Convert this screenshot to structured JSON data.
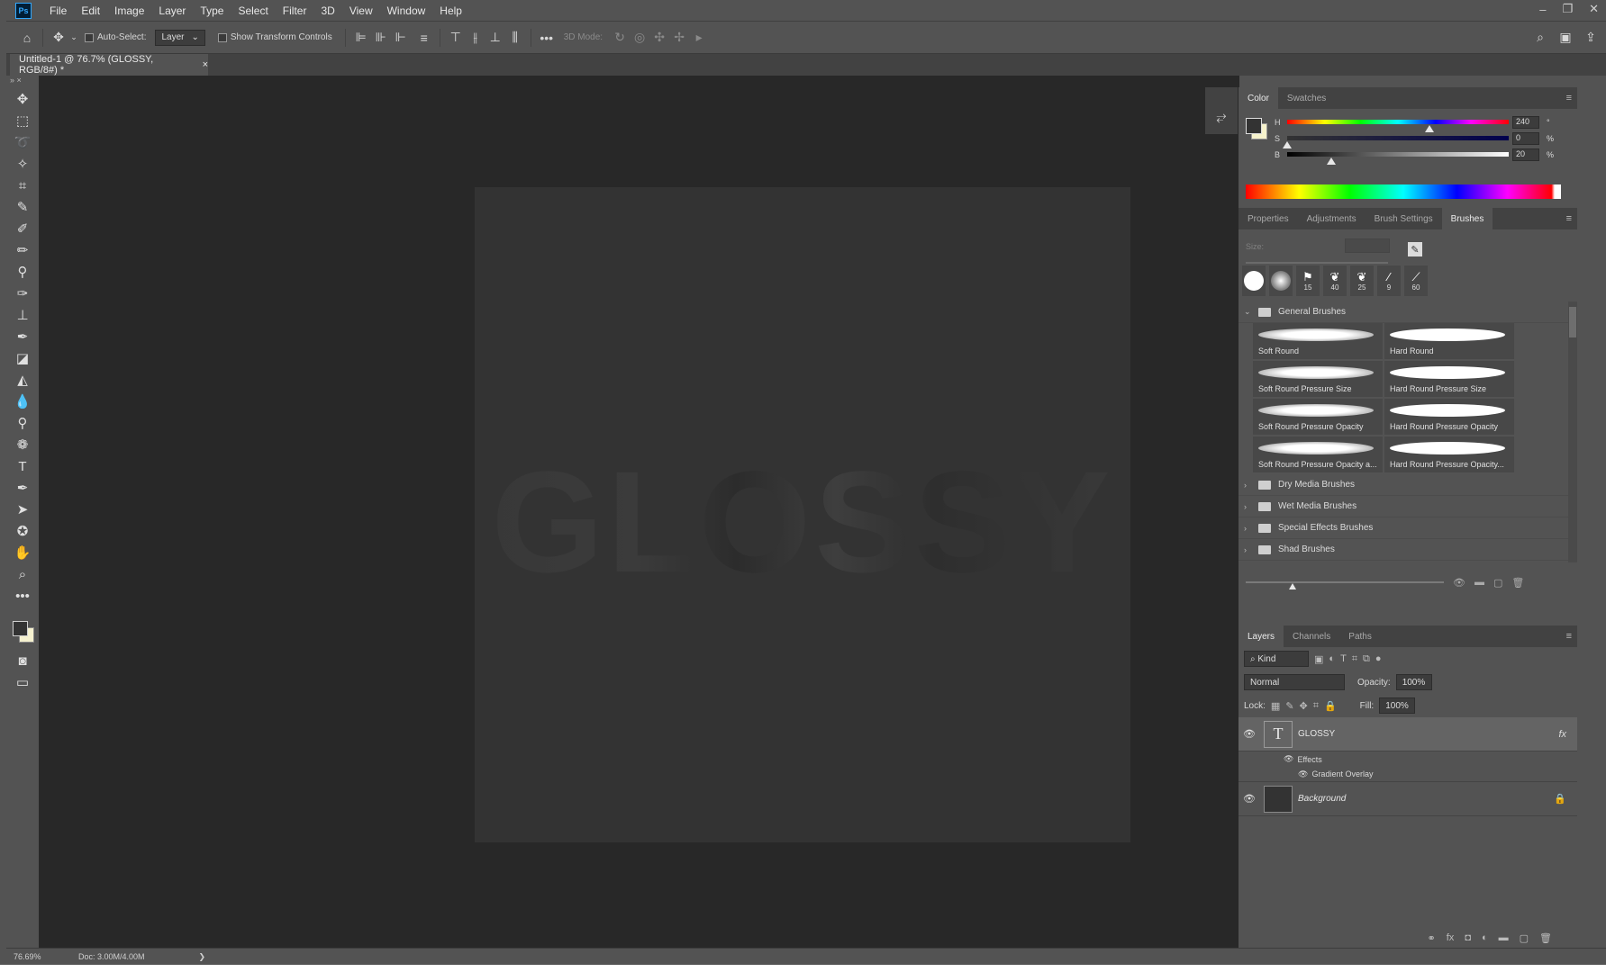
{
  "app": {
    "logo": "Ps"
  },
  "menu": [
    "File",
    "Edit",
    "Image",
    "Layer",
    "Type",
    "Select",
    "Filter",
    "3D",
    "View",
    "Window",
    "Help"
  ],
  "options": {
    "auto_select_label": "Auto-Select:",
    "auto_select_value": "Layer",
    "show_transform_label": "Show Transform Controls",
    "mode_3d_label": "3D Mode:",
    "more": "•••"
  },
  "document": {
    "tab_title": "Untitled-1 @ 76.7% (GLOSSY, RGB/8#) *",
    "close": "×",
    "canvas_text": "GLOSSY"
  },
  "color_panel": {
    "tabs": [
      "Color",
      "Swatches"
    ],
    "active_tab": "Color",
    "sliders": [
      {
        "label": "H",
        "value": "240",
        "unit": "°",
        "level": 0.66
      },
      {
        "label": "S",
        "value": "0",
        "unit": "%",
        "level": 0.0
      },
      {
        "label": "B",
        "value": "20",
        "unit": "%",
        "level": 0.2
      }
    ],
    "foreground": "#333333",
    "background": "#f5f1cf"
  },
  "brushes_panel": {
    "tabs": [
      "Properties",
      "Adjustments",
      "Brush Settings",
      "Brushes"
    ],
    "active_tab": "Brushes",
    "size_label": "Size:",
    "presets": [
      {
        "kind": "hard",
        "num": ""
      },
      {
        "kind": "soft",
        "num": ""
      },
      {
        "kind": "glyph",
        "glyph": "⚑",
        "num": "15"
      },
      {
        "kind": "glyph",
        "glyph": "❦",
        "num": "40"
      },
      {
        "kind": "glyph",
        "glyph": "❦",
        "num": "25"
      },
      {
        "kind": "glyph",
        "glyph": "⁄",
        "num": "9"
      },
      {
        "kind": "glyph",
        "glyph": "⟋",
        "num": "60"
      }
    ],
    "general_folder": "General Brushes",
    "brushes": [
      {
        "name": "Soft Round",
        "soft": true
      },
      {
        "name": "Hard Round",
        "soft": false
      },
      {
        "name": "Soft Round Pressure Size",
        "soft": true
      },
      {
        "name": "Hard Round Pressure Size",
        "soft": false
      },
      {
        "name": "Soft Round Pressure Opacity",
        "soft": true
      },
      {
        "name": "Hard Round Pressure Opacity",
        "soft": false
      },
      {
        "name": "Soft Round Pressure Opacity a...",
        "soft": true
      },
      {
        "name": "Hard Round Pressure Opacity...",
        "soft": false
      }
    ],
    "folders": [
      "Dry Media Brushes",
      "Wet Media Brushes",
      "Special Effects Brushes",
      "Shad Brushes"
    ]
  },
  "layers_panel": {
    "tabs": [
      "Layers",
      "Channels",
      "Paths"
    ],
    "active_tab": "Layers",
    "filter_kind": "Kind",
    "blend_mode": "Normal",
    "opacity_label": "Opacity:",
    "opacity_value": "100%",
    "lock_label": "Lock:",
    "fill_label": "Fill:",
    "fill_value": "100%",
    "layers": [
      {
        "name": "GLOSSY",
        "type": "text",
        "fx": "fx",
        "effects_label": "Effects",
        "effects": [
          "Gradient Overlay"
        ]
      },
      {
        "name": "Background",
        "type": "background"
      }
    ]
  },
  "status": {
    "zoom": "76.69%",
    "doc": "Doc: 3.00M/4.00M",
    "arrow": "❯"
  }
}
